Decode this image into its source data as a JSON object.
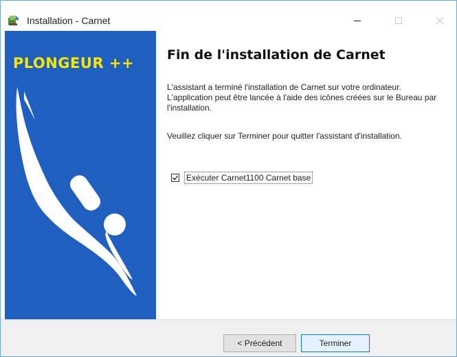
{
  "window": {
    "title": "Installation - Carnet"
  },
  "banner": {
    "title": "PLONGEUR ++",
    "background": "#1f5fbf",
    "title_color": "#f7e600"
  },
  "content": {
    "heading": "Fin de l'installation de Carnet",
    "paragraph1": "L'assistant a terminé l'installation de Carnet sur votre ordinateur. L'application peut être lancée à l'aide des icônes créées sur le Bureau par l'installation.",
    "paragraph2": "Veuillez cliquer sur Terminer pour quitter l'assistant d'installation.",
    "run_checkbox": {
      "label": "Exécuter Carnet1100 Carnet base",
      "checked": true
    }
  },
  "buttons": {
    "previous": "< Précédent",
    "finish": "Terminer"
  },
  "icons": {
    "app": "setup-app-icon",
    "minimize": "minimize-icon",
    "maximize": "maximize-icon",
    "close": "close-icon",
    "check": "checkmark-icon",
    "diver": "diver-silhouette-icon"
  }
}
